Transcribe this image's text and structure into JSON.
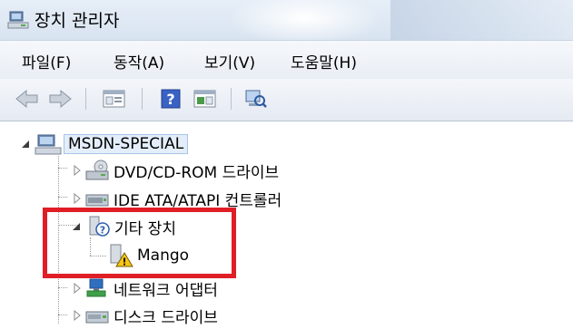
{
  "window": {
    "title": "장치 관리자"
  },
  "menu": [
    "파일(F)",
    "동작(A)",
    "보기(V)",
    "도움말(H)"
  ],
  "toolbar": {
    "buttons": [
      "back-icon",
      "forward-icon",
      "properties-icon",
      "help-icon",
      "update-driver-icon",
      "scan-hardware-icon"
    ]
  },
  "tree": {
    "root": "MSDN-SPECIAL",
    "items": [
      "DVD/CD-ROM 드라이브",
      "IDE ATA/ATAPI 컨트롤러",
      "기타 장치",
      "Mango",
      "네트워크 어댑터",
      "디스크 드라이브"
    ]
  },
  "colors": {
    "highlight_box": "#e01e26",
    "selection_bg": "#e4eefb"
  }
}
